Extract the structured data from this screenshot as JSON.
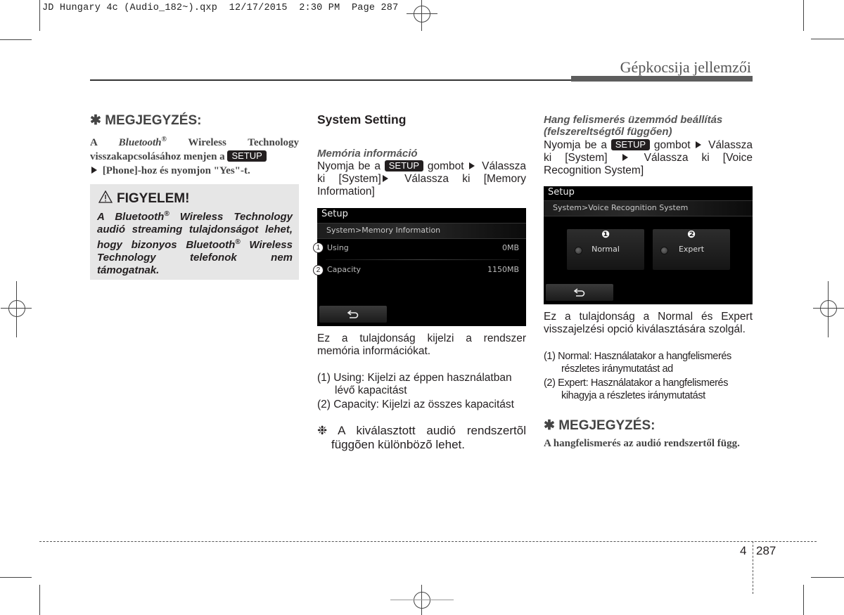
{
  "slug": {
    "text": "JD Hungary 4c (Audio_182~).qxp  12/17/2015  2:30 PM  Page 287"
  },
  "running_head": {
    "title": "Gépkocsija jellemzői"
  },
  "col1": {
    "note": {
      "title": "✱ MEGJEGYZÉS:",
      "line1_a": "A ",
      "line1_bt": "Bluetooth",
      "line1_reg": "®",
      "line1_b": " Wireless Technology visszakapcsolásához menjen a ",
      "setup_label": "SETUP",
      "line2": " [Phone]-hoz és nyomjon \"Yes\"-t."
    },
    "warning": {
      "title": "FIGYELEM!",
      "body_a": "A Bluetooth",
      "reg": "®",
      "body_b": " Wireless Technology audió streaming tulajdonságot lehet, hogy bizonyos Bluetooth",
      "body_c": " Wireless Technology telefonok nem támogatnak."
    }
  },
  "col2": {
    "section_title": "System Setting",
    "subtitle": "Memória információ",
    "instr_a": "Nyomja be a ",
    "setup_label": "SETUP",
    "instr_b": " gombot ",
    "instr_c": " Válassza ki [System]",
    "instr_d": " Válassza ki [Memory Information]",
    "screen": {
      "title": "Setup",
      "breadcrumb": "System>Memory Information",
      "rows": [
        {
          "callout": "1",
          "label": "Using",
          "value": "0MB"
        },
        {
          "callout": "2",
          "label": "Capacity",
          "value": "1150MB"
        }
      ],
      "back_icon": "back-arrow"
    },
    "description": "Ez a tulajdonság kijelzi a rendszer memória információkat.",
    "list": [
      {
        "num": "(1)",
        "text": "Using: Kijelzi az éppen használatban lévő kapacitást"
      },
      {
        "num": "(2)",
        "text": "Capacity: Kijelzi az összes kapacitást"
      }
    ],
    "footnote": "❉ A kiválasztott audió rendszertõl függõen különbözõ lehet."
  },
  "col3": {
    "subtitle_line1": "Hang felismerés üzemmód beállítás",
    "subtitle_line2": "(felszereltségtől függően)",
    "instr_a": "Nyomja be a ",
    "setup_label": "SETUP",
    "instr_b": " gombot ",
    "instr_c": " Válassza ki [System] ",
    "instr_d": " Válassza ki [Voice Recognition System]",
    "screen": {
      "title": "Setup",
      "breadcrumb": "System>Voice Recognition System",
      "options": [
        {
          "callout": "❶",
          "label": "Normal"
        },
        {
          "callout": "❷",
          "label": "Expert"
        }
      ],
      "back_icon": "back-arrow"
    },
    "description": "Ez a tulajdonság a Normal és Expert visszajelzési opció kiválasztására szolgál.",
    "list": [
      {
        "num": "(1)",
        "text": "Normal: Használatakor a hangfelismerés részletes iránymutatást ad"
      },
      {
        "num": "(2)",
        "text": "Expert: Használatakor a hangfelismerés kihagyja a részletes iránymutatást"
      }
    ],
    "note": {
      "title": "✱ MEGJEGYZÉS:",
      "body": "A hangfelismerés az audió rendszertől függ."
    }
  },
  "footer": {
    "chapter": "4",
    "page": "287"
  }
}
